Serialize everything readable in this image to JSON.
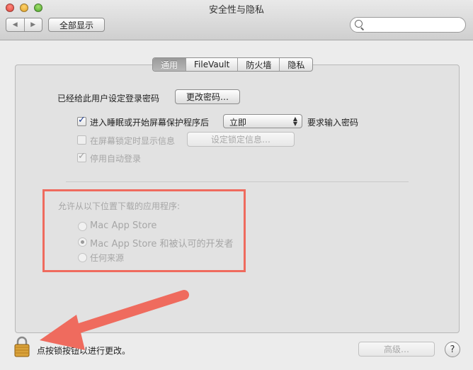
{
  "window": {
    "title": "安全性与隐私"
  },
  "toolbar": {
    "back_glyph": "◀",
    "forward_glyph": "▶",
    "show_all_label": "全部显示",
    "search_placeholder": ""
  },
  "tabs": [
    {
      "label": "通用",
      "active": true
    },
    {
      "label": "FileVault",
      "active": false
    },
    {
      "label": "防火墙",
      "active": false
    },
    {
      "label": "隐私",
      "active": false
    }
  ],
  "general": {
    "password_set_label": "已经给此用户设定登录密码",
    "change_password_button": "更改密码…",
    "require_password_label": "进入睡眠或开始屏幕保护程序后",
    "require_password_checked": true,
    "require_delay_value": "立即",
    "require_suffix": "要求输入密码",
    "show_message_label": "在屏幕锁定时显示信息",
    "show_message_checked": false,
    "set_lock_message_button": "设定锁定信息…",
    "disable_autologin_label": "停用自动登录",
    "disable_autologin_checked": true
  },
  "downloads": {
    "heading": "允许从以下位置下载的应用程序:",
    "options": [
      {
        "label": "Mac App Store",
        "selected": false
      },
      {
        "label": "Mac App Store 和被认可的开发者",
        "selected": true
      },
      {
        "label": "任何来源",
        "selected": false
      }
    ]
  },
  "footer": {
    "lock_text": "点按锁按钮以进行更改。",
    "advanced_button": "高级…",
    "help_glyph": "?"
  },
  "annotations": {
    "highlight_color": "#ef6b5e",
    "arrow_color": "#ef6b5e"
  }
}
